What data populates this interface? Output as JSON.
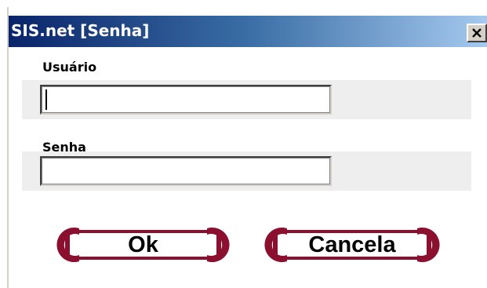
{
  "window": {
    "title": "SIS.net [Senha]",
    "close_icon": "close-icon"
  },
  "form": {
    "username_label": "Usuário",
    "username_value": "",
    "password_label": "Senha",
    "password_value": ""
  },
  "buttons": {
    "ok_label": "Ok",
    "cancel_label": "Cancela"
  },
  "colors": {
    "title_gradient_start": "#0a246a",
    "title_gradient_end": "#a6caf0",
    "button_accent": "#8b1030",
    "field_band": "#eeeeee"
  }
}
